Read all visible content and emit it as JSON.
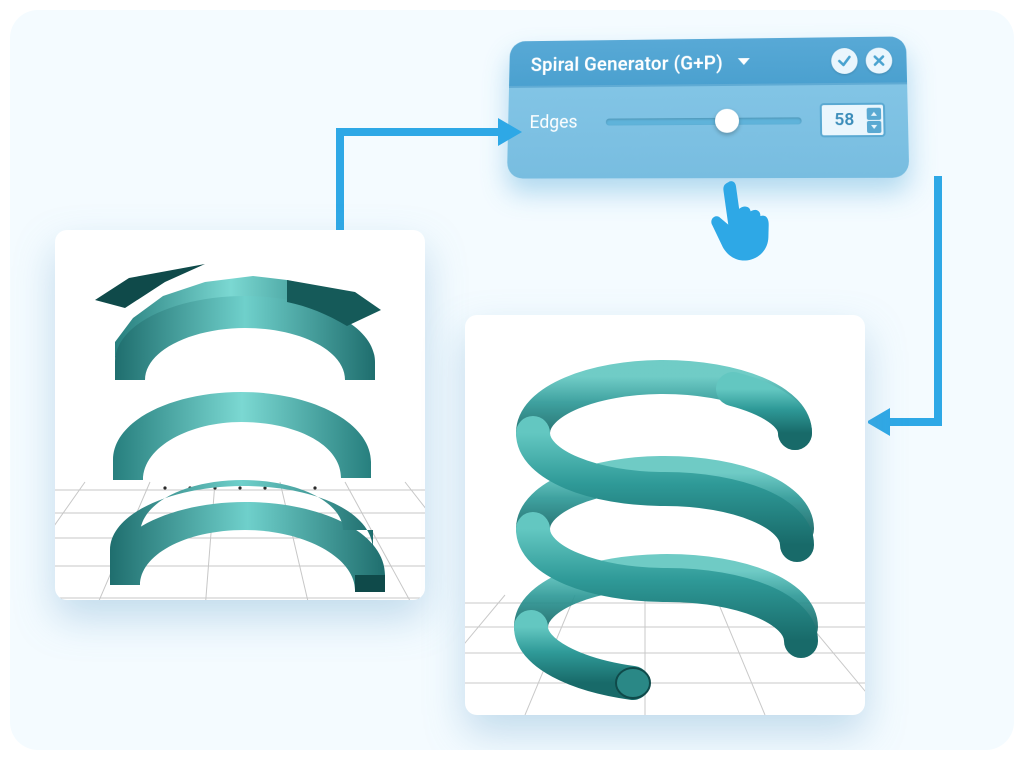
{
  "panel": {
    "title": "Spiral Generator (G+P)",
    "param_label": "Edges",
    "param_value": "58",
    "slider_percent": 62
  },
  "colors": {
    "accent": "#2ea8e6",
    "spiral": "#2f9a98",
    "panel_light": "#87c8e8",
    "panel_dark": "#4aa0cf"
  },
  "diagram": {
    "before_desc": "Low-poly flat-ribbon spiral",
    "after_desc": "Smooth round-tube spiral after increasing edges"
  }
}
